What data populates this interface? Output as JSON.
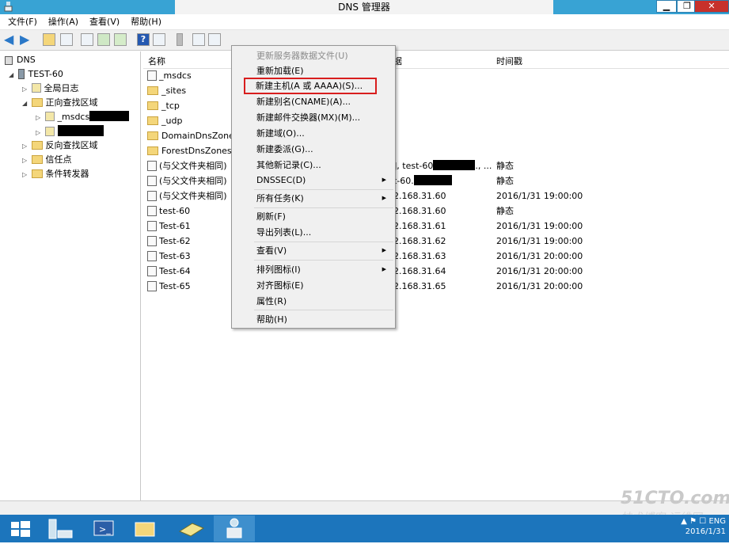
{
  "window": {
    "title": "DNS 管理器",
    "buttons": {
      "minimize": "▁",
      "maximize": "❐",
      "close": "✕"
    }
  },
  "menubar": [
    "文件(F)",
    "操作(A)",
    "查看(V)",
    "帮助(H)"
  ],
  "tree": {
    "root": "DNS",
    "server": "TEST-60",
    "global_log": "全局日志",
    "forward_zones": "正向查找区域",
    "msdcs": "_msdcs",
    "reverse_zones": "反向查找区域",
    "trust_points": "信任点",
    "conditional_forwarders": "条件转发器"
  },
  "list": {
    "headers": {
      "name": "名称",
      "data": "据",
      "timestamp": "时间戳"
    },
    "rows": [
      {
        "name": "_msdcs",
        "data": "",
        "time": ""
      },
      {
        "name": "_sites",
        "data": "",
        "time": ""
      },
      {
        "name": "_tcp",
        "data": "",
        "time": ""
      },
      {
        "name": "_udp",
        "data": "",
        "time": ""
      },
      {
        "name": "DomainDnsZones",
        "data": "",
        "time": ""
      },
      {
        "name": "ForestDnsZones",
        "data": "",
        "time": ""
      },
      {
        "name": "(与父文件夹相同)",
        "data": "], test-60",
        "data_suffix": "., ...",
        "time": "静态"
      },
      {
        "name": "(与父文件夹相同)",
        "data": "t-60.",
        "time": "静态"
      },
      {
        "name": "(与父文件夹相同)",
        "data": "2.168.31.60",
        "time": "2016/1/31 19:00:00"
      },
      {
        "name": "test-60",
        "data": "2.168.31.60",
        "time": "静态"
      },
      {
        "name": "Test-61",
        "data": "2.168.31.61",
        "time": "2016/1/31 19:00:00"
      },
      {
        "name": "Test-62",
        "data": "2.168.31.62",
        "time": "2016/1/31 19:00:00"
      },
      {
        "name": "Test-63",
        "data": "2.168.31.63",
        "time": "2016/1/31 20:00:00"
      },
      {
        "name": "Test-64",
        "data": "2.168.31.64",
        "time": "2016/1/31 20:00:00"
      },
      {
        "name": "Test-65",
        "data": "2.168.31.65",
        "time": "2016/1/31 20:00:00"
      }
    ]
  },
  "context_menu": {
    "update_server_data": "更新服务器数据文件(U)",
    "reload": "重新加载(E)",
    "new_host": "新建主机(A 或 AAAA)(S)...",
    "new_alias": "新建别名(CNAME)(A)...",
    "new_mx": "新建邮件交换器(MX)(M)...",
    "new_domain": "新建域(O)...",
    "new_delegation": "新建委派(G)...",
    "other_records": "其他新记录(C)...",
    "dnssec": "DNSSEC(D)",
    "all_tasks": "所有任务(K)",
    "refresh": "刷新(F)",
    "export_list": "导出列表(L)...",
    "view": "查看(V)",
    "arrange_icons": "排列图标(I)",
    "line_up_icons": "对齐图标(E)",
    "properties": "属性(R)",
    "help": "帮助(H)"
  },
  "tray": {
    "time_partial": "ENG",
    "date": "2016/1/31"
  },
  "watermark": {
    "line1": "51CTO.com",
    "line2": "技术博客 运维网"
  },
  "colors": {
    "titlebar": "#38a3d4",
    "taskbar": "#1c75bc",
    "highlight_box": "#d81e1e",
    "close": "#c7312b"
  }
}
